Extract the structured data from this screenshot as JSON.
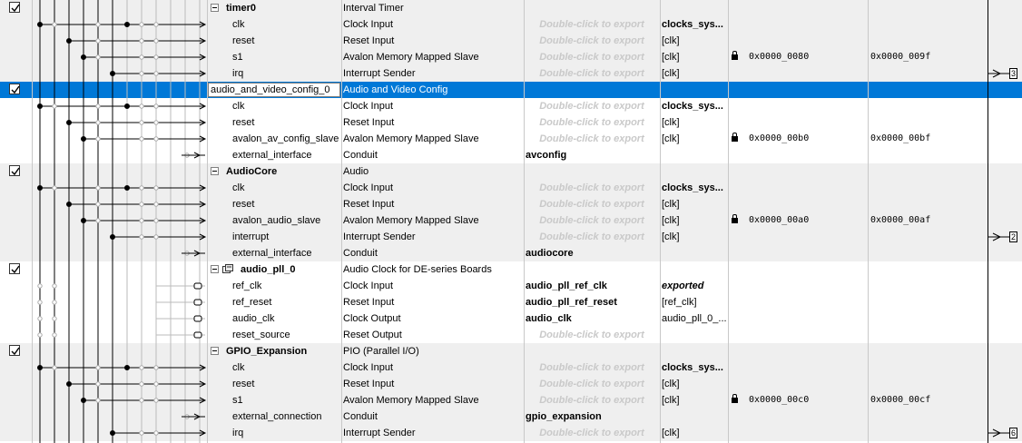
{
  "rows": [
    {
      "type": "component",
      "checked": true,
      "name": "timer0",
      "desc": "Interval Timer",
      "shade": true
    },
    {
      "type": "iface",
      "name": "clk",
      "desc": "Clock Input",
      "export": "Double-click to export",
      "export_hint": true,
      "clock": "clocks_sys...",
      "clock_bold": true,
      "shade": true
    },
    {
      "type": "iface",
      "name": "reset",
      "desc": "Reset Input",
      "export": "Double-click to export",
      "export_hint": true,
      "clock": "[clk]",
      "shade": true
    },
    {
      "type": "iface",
      "name": "s1",
      "desc": "Avalon Memory Mapped Slave",
      "export": "Double-click to export",
      "export_hint": true,
      "clock": "[clk]",
      "lock": true,
      "base": "0x0000_0080",
      "end": "0x0000_009f",
      "shade": true
    },
    {
      "type": "iface",
      "name": "irq",
      "desc": "Interrupt Sender",
      "export": "Double-click to export",
      "export_hint": true,
      "clock": "[clk]",
      "irq": "3",
      "shade": true
    },
    {
      "type": "component",
      "checked": true,
      "name": "audio_and_video_config_0",
      "desc": "Audio and Video Config",
      "editing": true,
      "selected": true
    },
    {
      "type": "iface",
      "name": "clk",
      "desc": "Clock Input",
      "export": "Double-click to export",
      "export_hint": true,
      "clock": "clocks_sys...",
      "clock_bold": true
    },
    {
      "type": "iface",
      "name": "reset",
      "desc": "Reset Input",
      "export": "Double-click to export",
      "export_hint": true,
      "clock": "[clk]"
    },
    {
      "type": "iface",
      "name": "avalon_av_config_slave",
      "desc": "Avalon Memory Mapped Slave",
      "export": "Double-click to export",
      "export_hint": true,
      "clock": "[clk]",
      "lock": true,
      "base": "0x0000_00b0",
      "end": "0x0000_00bf"
    },
    {
      "type": "iface",
      "name": "external_interface",
      "desc": "Conduit",
      "export": "avconfig",
      "export_bold": true,
      "clock": ""
    },
    {
      "type": "component",
      "checked": true,
      "name": "AudioCore",
      "desc": "Audio",
      "shade": true
    },
    {
      "type": "iface",
      "name": "clk",
      "desc": "Clock Input",
      "export": "Double-click to export",
      "export_hint": true,
      "clock": "clocks_sys...",
      "clock_bold": true,
      "shade": true
    },
    {
      "type": "iface",
      "name": "reset",
      "desc": "Reset Input",
      "export": "Double-click to export",
      "export_hint": true,
      "clock": "[clk]",
      "shade": true
    },
    {
      "type": "iface",
      "name": "avalon_audio_slave",
      "desc": "Avalon Memory Mapped Slave",
      "export": "Double-click to export",
      "export_hint": true,
      "clock": "[clk]",
      "lock": true,
      "base": "0x0000_00a0",
      "end": "0x0000_00af",
      "shade": true
    },
    {
      "type": "iface",
      "name": "interrupt",
      "desc": "Interrupt Sender",
      "export": "Double-click to export",
      "export_hint": true,
      "clock": "[clk]",
      "irq": "2",
      "shade": true
    },
    {
      "type": "iface",
      "name": "external_interface",
      "desc": "Conduit",
      "export": "audiocore",
      "export_bold": true,
      "clock": "",
      "shade": true
    },
    {
      "type": "component",
      "checked": true,
      "name": "audio_pll_0",
      "desc": "Audio Clock for DE-series Boards",
      "pll_icon": true
    },
    {
      "type": "iface",
      "name": "ref_clk",
      "desc": "Clock Input",
      "export": "audio_pll_ref_clk",
      "export_bold": true,
      "clock": "exported",
      "clock_italic": true
    },
    {
      "type": "iface",
      "name": "ref_reset",
      "desc": "Reset Input",
      "export": "audio_pll_ref_reset",
      "export_bold": true,
      "clock": "[ref_clk]"
    },
    {
      "type": "iface",
      "name": "audio_clk",
      "desc": "Clock Output",
      "export": "audio_clk",
      "export_bold": true,
      "clock": "audio_pll_0_..."
    },
    {
      "type": "iface",
      "name": "reset_source",
      "desc": "Reset Output",
      "export": "Double-click to export",
      "export_hint": true,
      "clock": ""
    },
    {
      "type": "component",
      "checked": true,
      "name": "GPIO_Expansion",
      "desc": "PIO (Parallel I/O)",
      "shade": true
    },
    {
      "type": "iface",
      "name": "clk",
      "desc": "Clock Input",
      "export": "Double-click to export",
      "export_hint": true,
      "clock": "clocks_sys...",
      "clock_bold": true,
      "shade": true
    },
    {
      "type": "iface",
      "name": "reset",
      "desc": "Reset Input",
      "export": "Double-click to export",
      "export_hint": true,
      "clock": "[clk]",
      "shade": true
    },
    {
      "type": "iface",
      "name": "s1",
      "desc": "Avalon Memory Mapped Slave",
      "export": "Double-click to export",
      "export_hint": true,
      "clock": "[clk]",
      "lock": true,
      "base": "0x0000_00c0",
      "end": "0x0000_00cf",
      "shade": true
    },
    {
      "type": "iface",
      "name": "external_connection",
      "desc": "Conduit",
      "export": "gpio_expansion",
      "export_bold": true,
      "clock": "",
      "shade": true
    },
    {
      "type": "iface",
      "name": "irq",
      "desc": "Interrupt Sender",
      "export": "Double-click to export",
      "export_hint": true,
      "clock": "[clk]",
      "irq": "6",
      "shade": true
    }
  ]
}
